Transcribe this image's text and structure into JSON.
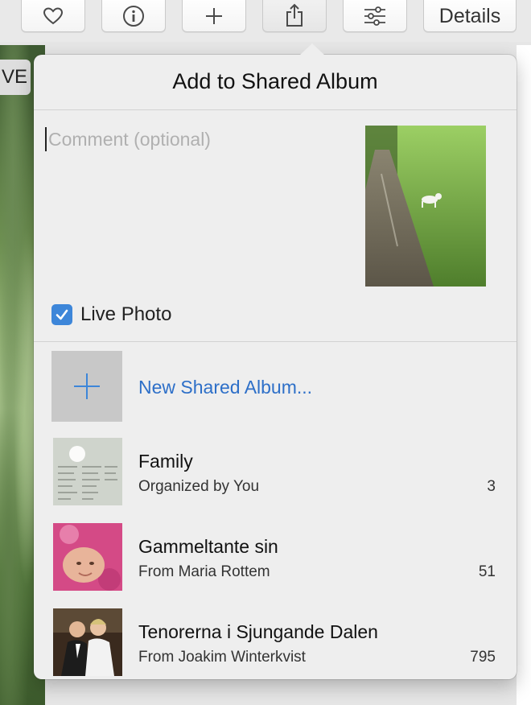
{
  "toolbar": {
    "buttons": [
      {
        "name": "favorite",
        "icon": "heart-icon"
      },
      {
        "name": "info",
        "icon": "info-icon"
      },
      {
        "name": "add",
        "icon": "plus-icon"
      },
      {
        "name": "share",
        "icon": "share-icon"
      },
      {
        "name": "adjust",
        "icon": "sliders-icon"
      }
    ],
    "details_label": "Details"
  },
  "background": {
    "partial_label": "VE"
  },
  "popover": {
    "title": "Add to Shared Album",
    "comment_placeholder": "Comment (optional)",
    "live_photo": {
      "label": "Live Photo",
      "checked": true
    },
    "new_album_label": "New Shared Album...",
    "albums": [
      {
        "title": "Family",
        "subtitle": "Organized by You",
        "count": "3"
      },
      {
        "title": "Gammeltante sin",
        "subtitle": "From Maria Rottem",
        "count": "51"
      },
      {
        "title": "Tenorerna i Sjungande Dalen",
        "subtitle": "From Joakim Winterkvist",
        "count": "795"
      }
    ]
  },
  "colors": {
    "accent": "#3d86d9",
    "link": "#2d6fc8",
    "popover_bg": "#eeeeee"
  }
}
